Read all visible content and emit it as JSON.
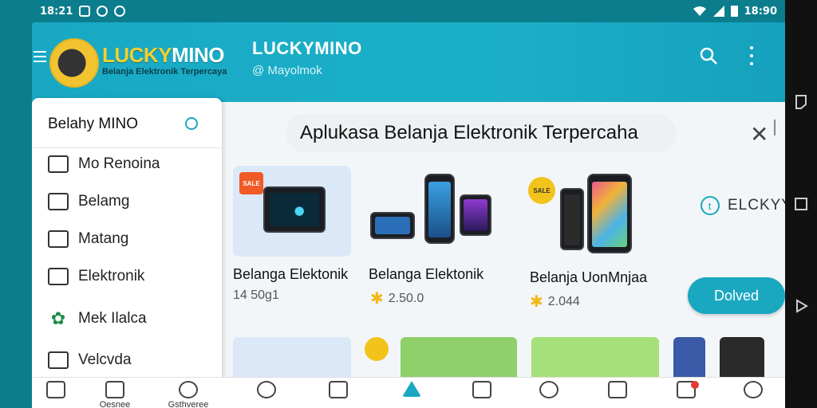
{
  "status_bar": {
    "time_left": "18:21",
    "time_right": "18:90"
  },
  "header": {
    "logo_lucky": "LUCKY",
    "logo_mino": "MINO",
    "logo_tagline": "Belanja Elektronik Terpercaya",
    "title": "LUCKYMINO",
    "subtitle": "@ Mayolmok"
  },
  "drawer": {
    "heading": "Belahy MINO",
    "items": [
      {
        "label": "Mo Renoina",
        "icon": "chat-icon"
      },
      {
        "label": "Belamg",
        "icon": "bag-icon"
      },
      {
        "label": "Matang",
        "icon": "mail-icon"
      },
      {
        "label": "Elektronik",
        "icon": "device-icon"
      },
      {
        "label": "Mek Ilalca",
        "icon": "puzzle-icon"
      },
      {
        "label": "Velcvda",
        "icon": "laptop-icon"
      }
    ]
  },
  "main": {
    "banner": "Aplukasa Belanja Elektronik Terpercaha",
    "side_label": "ELCKYY",
    "cta": "Dolved",
    "cards": [
      {
        "title": "Belanga Elektonik",
        "price": "14 50g1",
        "tag": "SALE"
      },
      {
        "title": "Belanga Elektonik",
        "price": "2.50.0",
        "tag": ""
      },
      {
        "title": "Belanja UonMnjaa",
        "price": "2.044",
        "tag": "SALE"
      }
    ]
  },
  "bottom_bar": {
    "items": [
      {
        "label": "",
        "icon": "store-icon"
      },
      {
        "label": "Oesnee",
        "icon": "box-icon"
      },
      {
        "label": "Gsthveree",
        "icon": "location-icon"
      },
      {
        "label": "",
        "icon": "user-icon"
      },
      {
        "label": "",
        "icon": "card-icon"
      },
      {
        "label": "",
        "icon": "triangle-icon"
      },
      {
        "label": "",
        "icon": "cart-icon"
      },
      {
        "label": "",
        "icon": "game-icon"
      },
      {
        "label": "",
        "icon": "wallet-icon"
      },
      {
        "label": "",
        "icon": "home-icon"
      },
      {
        "label": "",
        "icon": "person-icon"
      }
    ]
  }
}
